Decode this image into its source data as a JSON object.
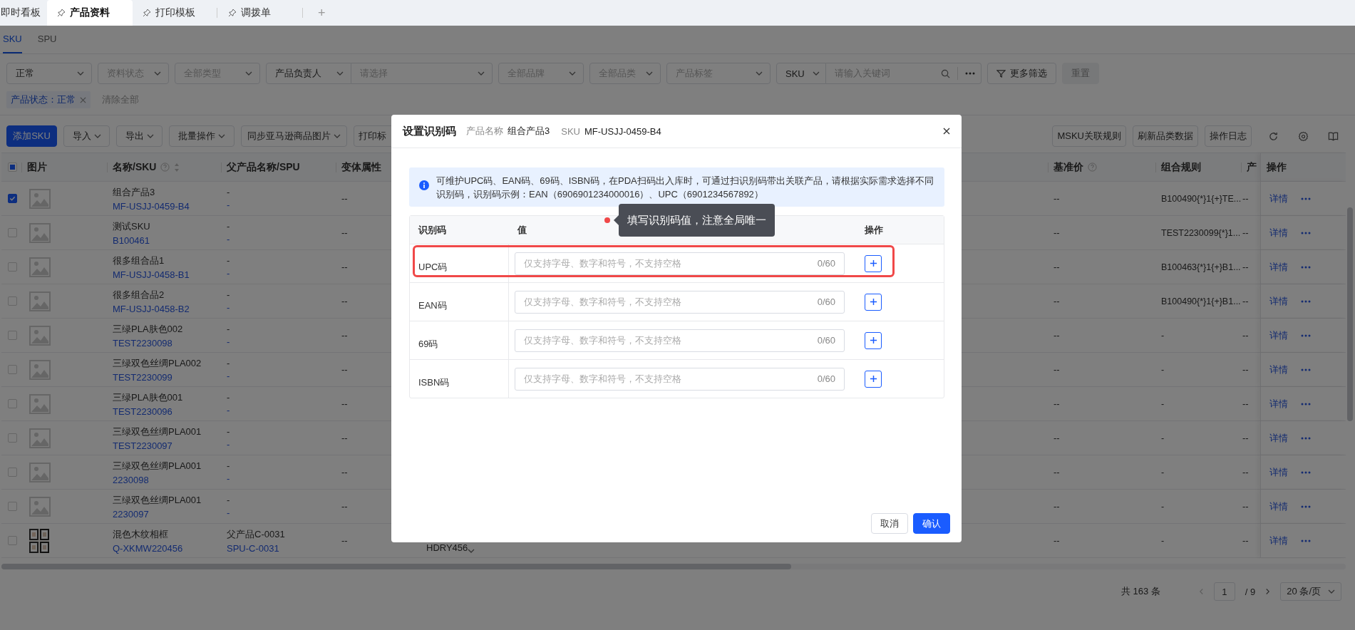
{
  "top_tabs": [
    {
      "label": "即时看板",
      "selected": false,
      "pinned": false
    },
    {
      "label": "产品资料",
      "selected": true,
      "pinned": true
    },
    {
      "label": "打印模板",
      "selected": false,
      "pinned": true
    },
    {
      "label": "调拨单",
      "selected": false,
      "pinned": true
    }
  ],
  "add_tab": "+",
  "sub_tabs": [
    {
      "label": "SKU",
      "selected": true
    },
    {
      "label": "SPU",
      "selected": false
    }
  ],
  "filters": [
    {
      "kind": "select",
      "value": "正常"
    },
    {
      "kind": "select",
      "placeholder": "资料状态"
    },
    {
      "kind": "select",
      "placeholder": "全部类型"
    },
    {
      "kind": "combo",
      "value": "产品负责人",
      "placeholder": "请选择"
    },
    {
      "kind": "select",
      "placeholder": "全部品牌"
    },
    {
      "kind": "select",
      "placeholder": "全部品类"
    },
    {
      "kind": "select",
      "placeholder": "产品标签"
    },
    {
      "kind": "search",
      "value": "SKU",
      "placeholder": "请输入关键词"
    }
  ],
  "more_filters_button": "更多筛选",
  "reset_button": "重置",
  "active_filters": [
    {
      "label": "产品状态：正常"
    }
  ],
  "clear_all": "清除全部",
  "toolbar_left": [
    {
      "label": "添加SKU",
      "kind": "primary"
    },
    {
      "label": "导入",
      "kind": "dropdown"
    },
    {
      "label": "导出",
      "kind": "dropdown"
    },
    {
      "label": "批量操作",
      "kind": "dropdown"
    },
    {
      "label": "同步亚马逊商品图片",
      "kind": "dropdown"
    },
    {
      "label": "打印标",
      "kind": "plain"
    }
  ],
  "toolbar_right": [
    "MSKU关联规则",
    "刷新品类数据",
    "操作日志"
  ],
  "table": {
    "all_selected": false,
    "some_selected": true,
    "columns": [
      {
        "label": "图片"
      },
      {
        "label": "名称/SKU",
        "help": true,
        "sortable": true
      },
      {
        "label": "父产品名称/SPU"
      },
      {
        "label": "变体属性"
      },
      {
        "label": "基准价",
        "help": true
      },
      {
        "label": "组合规则"
      },
      {
        "label": "产"
      },
      {
        "label": "操作"
      }
    ],
    "rows": [
      {
        "selected": true,
        "photo": false,
        "name": "组合产品3",
        "sku": "MF-USJJ-0459-B4",
        "parent_name": "-",
        "spu": "-",
        "variant": "--",
        "base_price": "--",
        "combo_rule": "B100490{*}1{+}TE...",
        "product": "--",
        "detail": "详情"
      },
      {
        "selected": false,
        "photo": false,
        "name": "测试SKU",
        "sku": "B100461",
        "parent_name": "-",
        "spu": "-",
        "variant": "--",
        "base_price": "--",
        "combo_rule": "TEST2230099{*}1...",
        "product": "--",
        "detail": "详情"
      },
      {
        "selected": false,
        "photo": false,
        "name": "很多组合品1",
        "sku": "MF-USJJ-0458-B1",
        "parent_name": "-",
        "spu": "-",
        "variant": "--",
        "base_price": "--",
        "combo_rule": "B100463{*}1{+}B1...",
        "product": "--",
        "detail": "详情"
      },
      {
        "selected": false,
        "photo": false,
        "name": "很多组合品2",
        "sku": "MF-USJJ-0458-B2",
        "parent_name": "-",
        "spu": "-",
        "variant": "--",
        "base_price": "--",
        "combo_rule": "B100490{*}1{+}B1...",
        "product": "--",
        "detail": "详情"
      },
      {
        "selected": false,
        "photo": false,
        "name": "三绿PLA肤色002",
        "sku": "TEST2230098",
        "parent_name": "-",
        "spu": "-",
        "variant": "--",
        "base_price": "--",
        "combo_rule": "-",
        "product": "--",
        "detail": "详情"
      },
      {
        "selected": false,
        "photo": false,
        "name": "三绿双色丝绸PLA002",
        "sku": "TEST2230099",
        "parent_name": "-",
        "spu": "-",
        "variant": "--",
        "base_price": "--",
        "combo_rule": "-",
        "product": "--",
        "detail": "详情"
      },
      {
        "selected": false,
        "photo": false,
        "name": "三绿PLA肤色001",
        "sku": "TEST2230096",
        "parent_name": "-",
        "spu": "-",
        "variant": "--",
        "base_price": "--",
        "combo_rule": "-",
        "product": "--",
        "detail": "详情"
      },
      {
        "selected": false,
        "photo": false,
        "name": "三绿双色丝绸PLA001",
        "sku": "TEST2230097",
        "parent_name": "-",
        "spu": "-",
        "variant": "--",
        "base_price": "--",
        "combo_rule": "-",
        "product": "--",
        "detail": "详情"
      },
      {
        "selected": false,
        "photo": false,
        "name": "三绿双色丝绸PLA001",
        "sku": "2230098",
        "parent_name": "-",
        "spu": "-",
        "variant": "--",
        "base_price": "--",
        "combo_rule": "-",
        "product": "--",
        "detail": "详情"
      },
      {
        "selected": false,
        "photo": false,
        "name": "三绿双色丝绸PLA001",
        "sku": "2230097",
        "parent_name": "-",
        "spu": "-",
        "variant": "--",
        "base_price": "--",
        "combo_rule": "-",
        "product": "--",
        "detail": "详情"
      },
      {
        "selected": false,
        "photo": true,
        "name": "混色木纹相框",
        "sku": "Q-XKMW220456",
        "parent_name": "父产品C-0031",
        "spu": "SPU-C-0031",
        "variant": "--",
        "column_5": "HDRY456",
        "base_price": "--",
        "combo_rule": "-",
        "product": "--",
        "detail": "详情"
      }
    ]
  },
  "pagination": {
    "total": "共 163 条",
    "page": "1",
    "pages": "/ 9",
    "page_size": "20 条/页"
  },
  "modal": {
    "title": "设置识别码",
    "product_label": "产品名称",
    "product_name": "组合产品3",
    "sku_label": "SKU",
    "sku": "MF-USJJ-0459-B4",
    "notice": "可维护UPC码、EAN码、69码、ISBN码，在PDA扫码出入库时，可通过扫识别码带出关联产品，请根据实际需求选择不同识别码，识别码示例：EAN（6906901234000016）、UPC（6901234567892）",
    "columns": [
      "识别码",
      "值",
      "操作"
    ],
    "codes": [
      {
        "type": "UPC码",
        "placeholder": "仅支持字母、数字和符号，不支持空格",
        "count": "0/60",
        "highlighted": true
      },
      {
        "type": "EAN码",
        "placeholder": "仅支持字母、数字和符号，不支持空格",
        "count": "0/60",
        "highlighted": false
      },
      {
        "type": "69码",
        "placeholder": "仅支持字母、数字和符号，不支持空格",
        "count": "0/60",
        "highlighted": false
      },
      {
        "type": "ISBN码",
        "placeholder": "仅支持字母、数字和符号，不支持空格",
        "count": "0/60",
        "highlighted": false
      }
    ],
    "cancel_button": "取消",
    "confirm_button": "确认",
    "guide_tip": "填写识别码值，注意全局唯一"
  }
}
